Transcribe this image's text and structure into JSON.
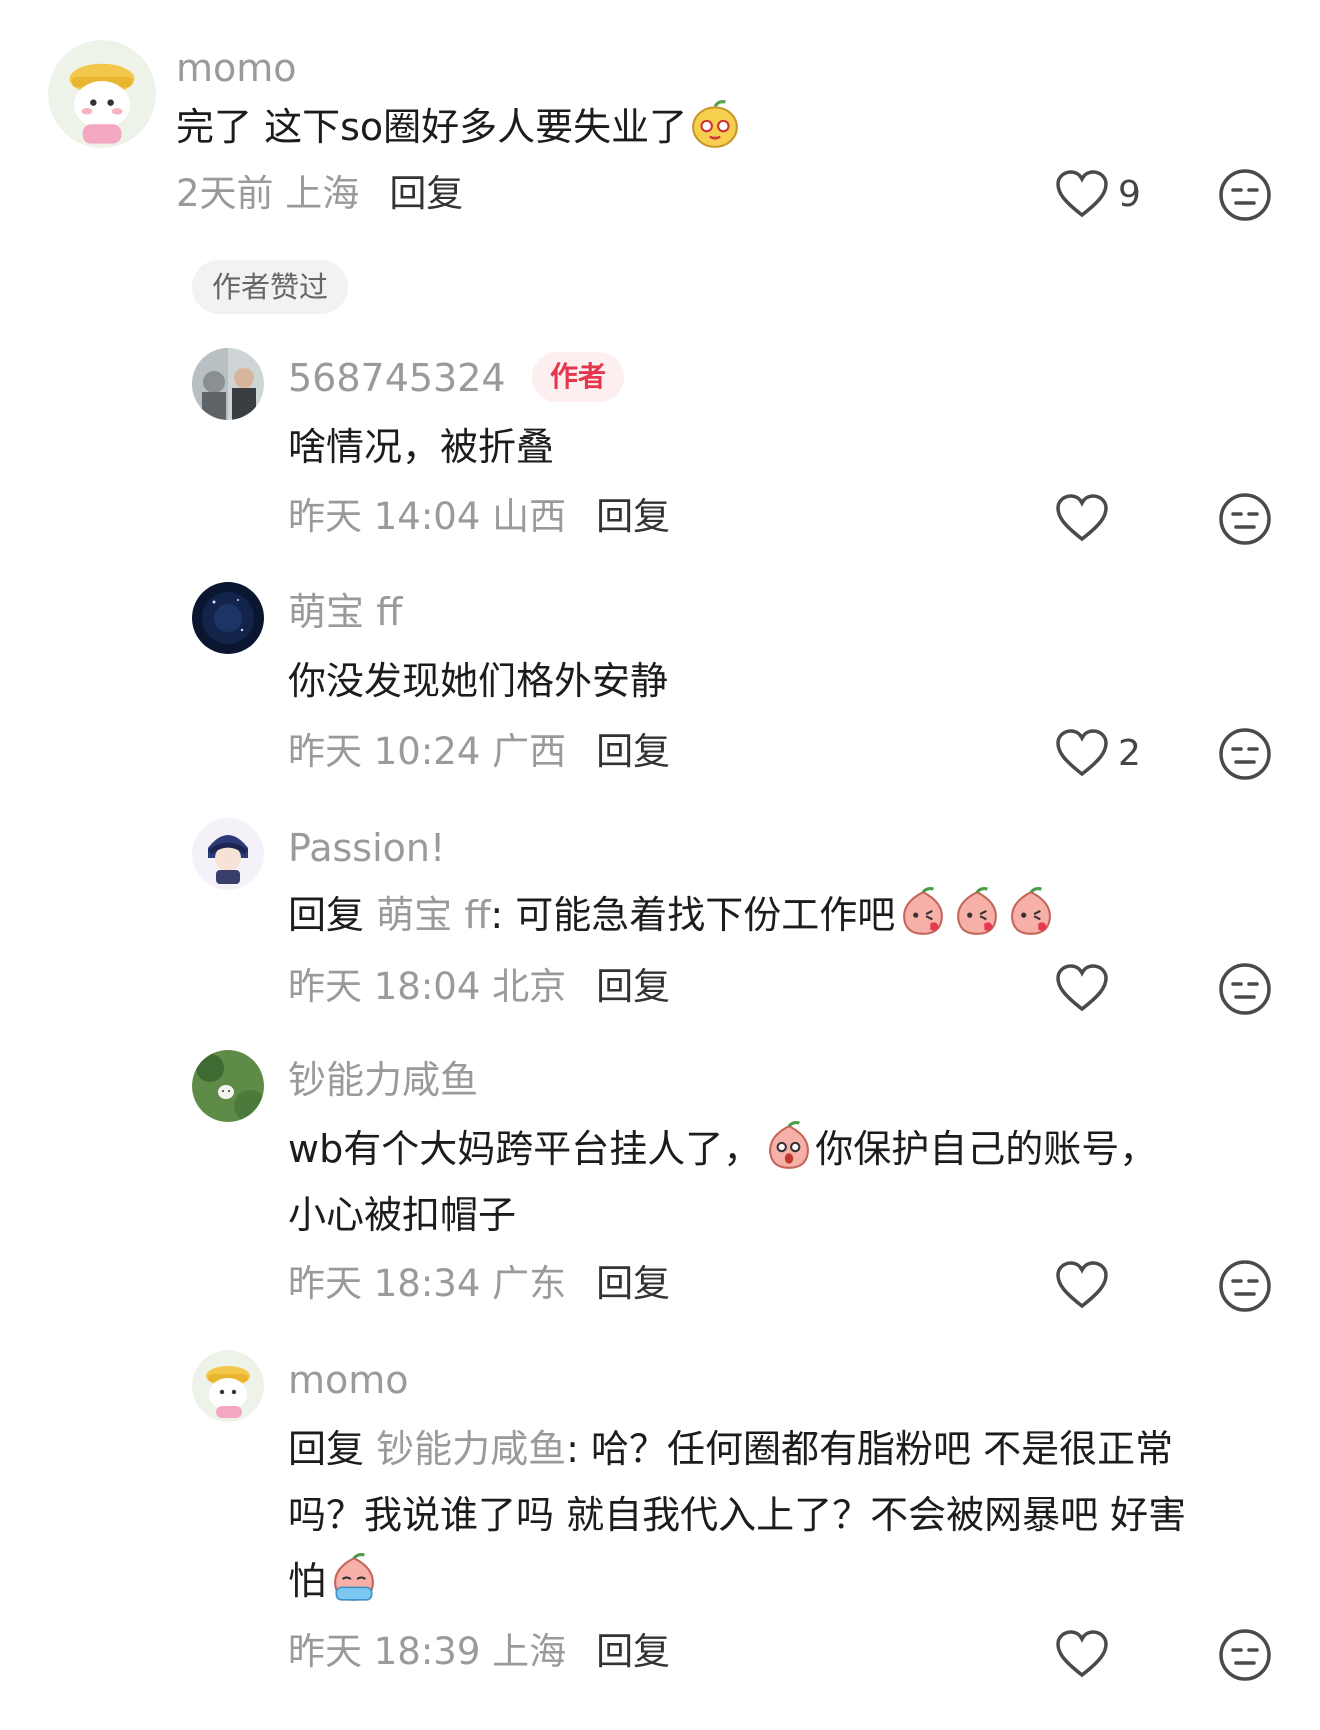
{
  "comments": [
    {
      "username": "momo",
      "text": "完了 这下so圈好多人要失业了",
      "time_location": "2天前 上海",
      "reply_label": "回复",
      "likes": "9",
      "liked_by_author": "作者赞过",
      "emoji": "lemon-face-emoji"
    },
    {
      "username": "568745324",
      "author_badge": "作者",
      "text": "啥情况，被折叠",
      "time_location": "昨天 14:04 山西",
      "reply_label": "回复"
    },
    {
      "username": "萌宝 ff",
      "text": "你没发现她们格外安静",
      "time_location": "昨天 10:24 广西",
      "reply_label": "回复",
      "likes": "2"
    },
    {
      "username": "Passion!",
      "reply_prefix": "回复",
      "mention": "萌宝 ff",
      "text": ": 可能急着找下份工作吧",
      "time_location": "昨天 18:04 北京",
      "reply_label": "回复",
      "emoji": "peach-kiss-emoji"
    },
    {
      "username": "钞能力咸鱼",
      "text_line1_a": "wb有个大妈跨平台挂人了，",
      "text_line1_b": "你保护自己的账号，",
      "text_line2": "小心被扣帽子",
      "time_location": "昨天 18:34 广东",
      "reply_label": "回复",
      "emoji": "peach-shocked-emoji"
    },
    {
      "username": "momo",
      "reply_prefix": "回复",
      "mention": "钞能力咸鱼",
      "text_line1": ": 哈？任何圈都有脂粉吧 不是很正常",
      "text_line2": "吗？我说谁了吗 就自我代入上了？不会被网暴吧 好害",
      "text_line3": "怕",
      "time_location": "昨天 18:39 上海",
      "reply_label": "回复",
      "emoji": "peach-crying-emoji"
    }
  ],
  "colors": {
    "accent_author": "#e6364e",
    "muted_text": "#9a9a9a",
    "icon_stroke": "#4a4a4a"
  }
}
